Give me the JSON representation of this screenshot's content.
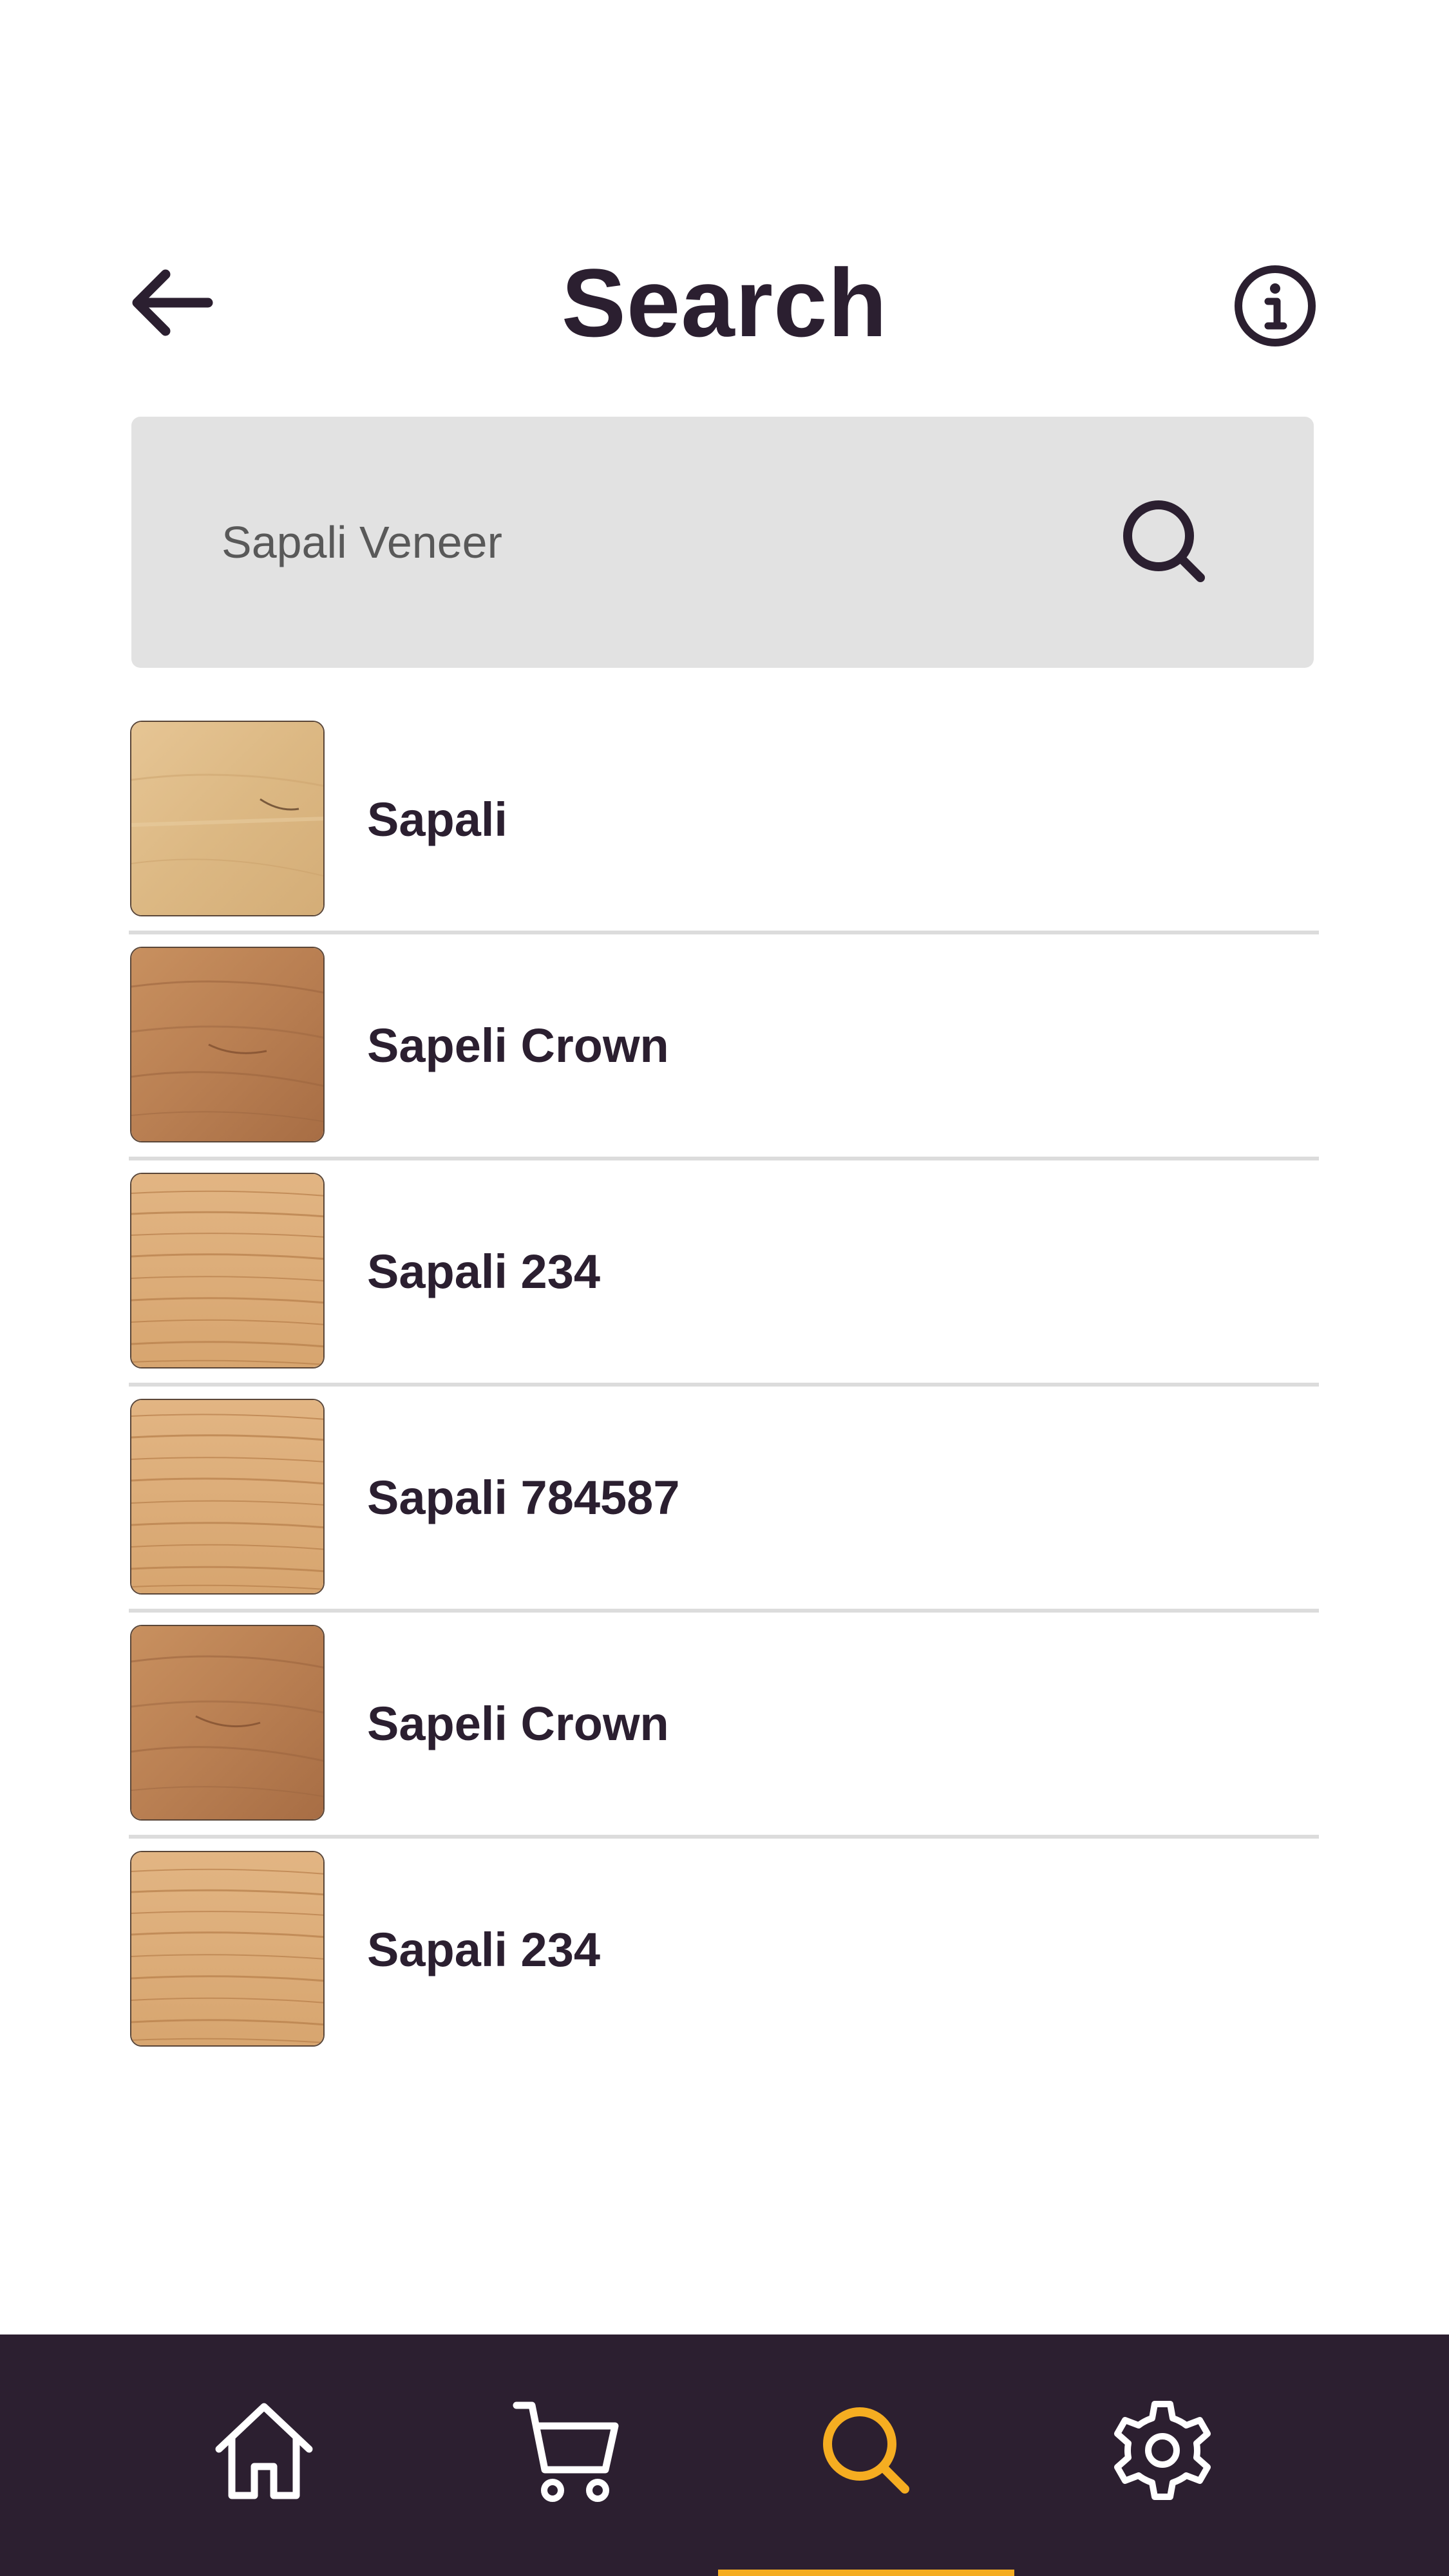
{
  "header": {
    "title": "Search"
  },
  "search": {
    "value": "Sapali Veneer"
  },
  "results": [
    {
      "label": "Sapali",
      "texture": "pale"
    },
    {
      "label": "Sapeli Crown",
      "texture": "medium"
    },
    {
      "label": "Sapali 234",
      "texture": "oak"
    },
    {
      "label": "Sapali 784587",
      "texture": "oak"
    },
    {
      "label": "Sapeli Crown",
      "texture": "medium"
    },
    {
      "label": "Sapali 234",
      "texture": "oak"
    }
  ],
  "bottom_nav": {
    "items": [
      {
        "icon": "home-icon"
      },
      {
        "icon": "cart-icon"
      },
      {
        "icon": "search-icon",
        "active": true
      },
      {
        "icon": "gear-icon"
      }
    ]
  },
  "colors": {
    "primary_dark": "#2c1f30",
    "accent": "#f5ad21",
    "search_bg": "#e2e2e2"
  }
}
